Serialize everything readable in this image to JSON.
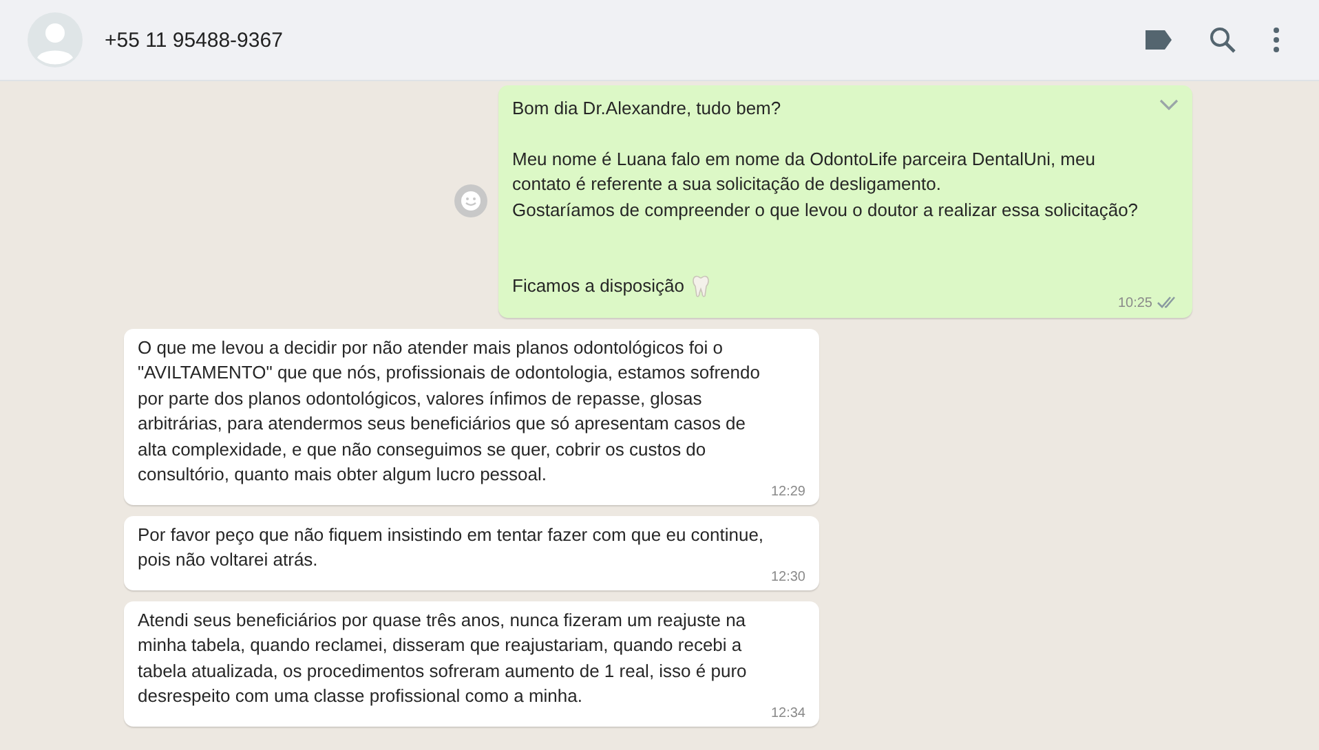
{
  "header": {
    "contact": "+55 11 95488-9367"
  },
  "messages": [
    {
      "kind": "outgoing",
      "paragraphs": [
        "Bom dia Dr.Alexandre, tudo bem?",
        "Meu nome é Luana falo em nome da OdontoLife parceira DentalUni, meu contato é referente a sua solicitação de desligamento.\nGostaríamos de compreender o que levou  o doutor a realizar essa solicitação?"
      ],
      "signoff": "Ficamos a disposição",
      "time": "10:25",
      "read": false
    },
    {
      "kind": "incoming",
      "paragraphs": [
        "O que me levou a decidir por não atender mais planos odontológicos foi o \"AVILTAMENTO\" que que nós, profissionais de odontologia, estamos sofrendo por parte dos planos odontológicos, valores ínfimos de repasse, glosas arbitrárias, para atendermos seus beneficiários que só apresentam casos de alta complexidade, e que não conseguimos se quer, cobrir os custos do consultório, quanto mais obter algum lucro pessoal."
      ],
      "time": "12:29"
    },
    {
      "kind": "incoming",
      "paragraphs": [
        "Por favor peço que não fiquem insistindo em tentar fazer com que eu continue, pois não voltarei atrás."
      ],
      "time": "12:30"
    },
    {
      "kind": "incoming",
      "paragraphs": [
        "Atendi seus beneficiários por quase três anos, nunca fizeram um reajuste na minha tabela, quando reclamei, disseram que reajustariam, quando recebi a tabela atualizada, os procedimentos sofreram aumento de 1 real, isso é puro desrespeito com uma classe profissional como a minha."
      ],
      "time": "12:34"
    }
  ]
}
